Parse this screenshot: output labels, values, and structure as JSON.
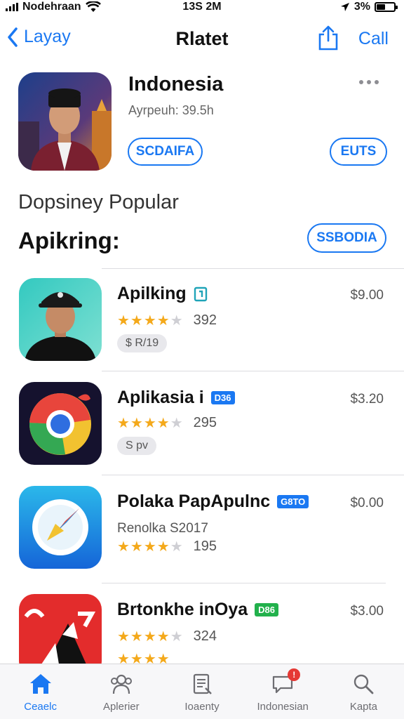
{
  "status_bar": {
    "carrier": "Nodehraan",
    "time": "13S 2M",
    "battery": "3%"
  },
  "nav": {
    "back_label": "Layay",
    "title": "Rlatet",
    "action_label": "Call"
  },
  "featured": {
    "title": "Indonesia",
    "subtitle": "Ayrpeuh: 39.5h",
    "get_label": "SCDAIFA",
    "edit_label": "EUTS"
  },
  "section": {
    "subtitle": "Dopsiney Popular",
    "title": "Apikring:",
    "see_all_label": "SSBODIA"
  },
  "apps": [
    {
      "name": "Apilking",
      "badge": "",
      "price": "$9.00",
      "rating": 4,
      "review_count": "392",
      "tag": "$ R/19",
      "developer": ""
    },
    {
      "name": "Aplikasia i",
      "badge": "D36",
      "price": "$3.20",
      "rating": 4,
      "review_count": "295",
      "tag": "S pv",
      "developer": ""
    },
    {
      "name": "Polaka PapApulnc",
      "badge": "G8TO",
      "price": "$0.00",
      "rating": 4,
      "review_count": "195",
      "tag": "",
      "developer": "Renolka S2017"
    },
    {
      "name": "Brtonkhe inOya",
      "badge": "D86",
      "price": "$3.00",
      "rating": 4,
      "review_count": "324",
      "tag": "",
      "developer": ""
    }
  ],
  "tabs": [
    {
      "label": "Ceaelc",
      "icon": "home-icon",
      "active": true
    },
    {
      "label": "Aplerier",
      "icon": "people-icon",
      "active": false
    },
    {
      "label": "Ioaenty",
      "icon": "document-icon",
      "active": false
    },
    {
      "label": "Indonesian",
      "icon": "chat-icon",
      "active": false,
      "badge": "!"
    },
    {
      "label": "Kapta",
      "icon": "search-icon",
      "active": false
    }
  ],
  "colors": {
    "accent": "#1a78f2",
    "star": "#f4a91b",
    "badge_green": "#22b14c",
    "notification": "#e53935"
  }
}
